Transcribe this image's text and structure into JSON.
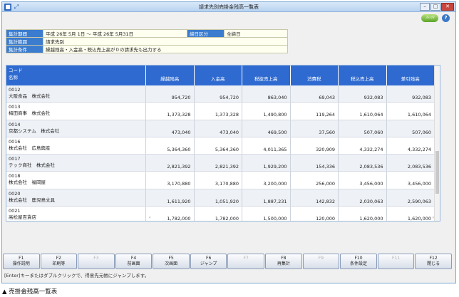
{
  "window": {
    "title": "請求先別売掛金残高一覧表"
  },
  "toolbar": {
    "logo": "ﾌﾚｯｸｽ",
    "help": "?"
  },
  "info": [
    {
      "label": "集計期間",
      "value": "平成 26年 5月 1日 〜 平成 26年 5月31日",
      "label2": "締日区分",
      "value2": "全締日"
    },
    {
      "label": "集計範囲",
      "value": "請求先別"
    },
    {
      "label": "集計条件",
      "value": "繰越残高・入金高・税込売上高が０の請求先も出力する"
    }
  ],
  "grid": {
    "head_code": "コード",
    "head_name": "名称",
    "columns": [
      "繰越残高",
      "入金高",
      "税抜売上高",
      "消費税",
      "税込売上高",
      "差引残高"
    ],
    "rows": [
      {
        "code": "0012",
        "name": "大阪食品　株式会社",
        "values": [
          "954,720",
          "954,720",
          "863,040",
          "69,043",
          "932,083",
          "932,083"
        ]
      },
      {
        "code": "0013",
        "name": "梅田商事　株式会社",
        "values": [
          "1,373,328",
          "1,373,328",
          "1,490,800",
          "119,264",
          "1,610,064",
          "1,610,064"
        ]
      },
      {
        "code": "0014",
        "name": "京都システム　株式会社",
        "values": [
          "473,040",
          "473,040",
          "469,500",
          "37,560",
          "507,060",
          "507,060"
        ]
      },
      {
        "code": "0016",
        "name": "株式会社　広島興産",
        "values": [
          "5,364,360",
          "5,364,360",
          "4,011,365",
          "320,909",
          "4,332,274",
          "4,332,274"
        ]
      },
      {
        "code": "0017",
        "name": "テック商社　株式会社",
        "values": [
          "2,821,392",
          "2,821,392",
          "1,929,200",
          "154,336",
          "2,083,536",
          "2,083,536"
        ]
      },
      {
        "code": "0018",
        "name": "株式会社　福岡屋",
        "values": [
          "3,170,880",
          "3,170,880",
          "3,200,000",
          "256,000",
          "3,456,000",
          "3,456,000"
        ]
      },
      {
        "code": "0020",
        "name": "株式会社　鹿児島文具",
        "values": [
          "1,611,920",
          "1,051,920",
          "1,887,231",
          "142,832",
          "2,030,063",
          "2,590,063"
        ]
      },
      {
        "code": "0021",
        "name": "高松屋百貨店",
        "values": [
          "1,782,000",
          "1,782,000",
          "1,500,000",
          "120,000",
          "1,620,000",
          "1,620,000"
        ]
      }
    ]
  },
  "fkeys": [
    {
      "key": "F1",
      "label": "操作説明",
      "enabled": true
    },
    {
      "key": "F2",
      "label": "印刷等",
      "enabled": true
    },
    {
      "key": "F3",
      "label": "",
      "enabled": false
    },
    {
      "key": "F4",
      "label": "前画面",
      "enabled": true
    },
    {
      "key": "F5",
      "label": "次画面",
      "enabled": true
    },
    {
      "key": "F6",
      "label": "ジャンプ",
      "enabled": true
    },
    {
      "key": "F7",
      "label": "",
      "enabled": false
    },
    {
      "key": "F8",
      "label": "再集計",
      "enabled": true
    },
    {
      "key": "F9",
      "label": "",
      "enabled": false
    },
    {
      "key": "F10",
      "label": "条件設定",
      "enabled": true
    },
    {
      "key": "F11",
      "label": "",
      "enabled": false
    },
    {
      "key": "F12",
      "label": "閉じる",
      "enabled": true
    }
  ],
  "status": "[Enter]キーまたはダブルクリックで、得意先元帳にジャンプします。",
  "caption": "▲ 売掛金残高一覧表"
}
